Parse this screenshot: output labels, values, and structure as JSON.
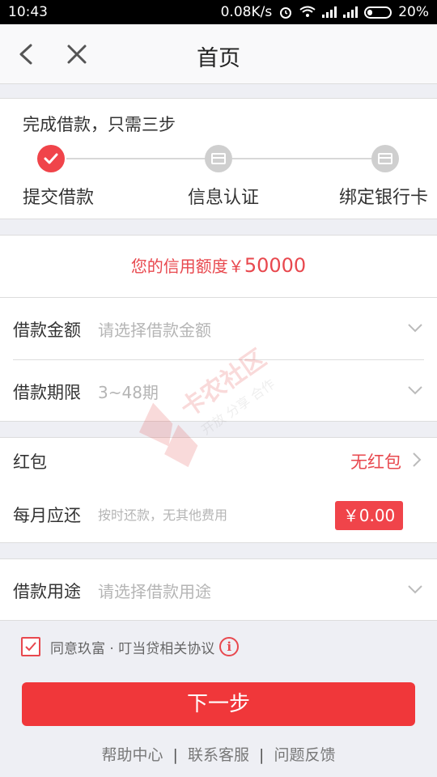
{
  "status_bar": {
    "time": "10:43",
    "speed": "0.08K/s",
    "battery": "20%"
  },
  "nav": {
    "title": "首页"
  },
  "steps": {
    "title": "完成借款，只需三步",
    "items": [
      {
        "label": "提交借款",
        "state": "done"
      },
      {
        "label": "信息认证",
        "state": "todo"
      },
      {
        "label": "绑定银行卡",
        "state": "todo"
      }
    ]
  },
  "credit": {
    "prefix": "您的信用额度￥",
    "amount": "50000"
  },
  "form": {
    "amount": {
      "label": "借款金额",
      "placeholder": "请选择借款金额"
    },
    "term": {
      "label": "借款期限",
      "placeholder": "3~48期"
    }
  },
  "bonus": {
    "label": "红包",
    "value": "无红包"
  },
  "monthly": {
    "label": "每月应还",
    "note": "按时还款，无其他费用",
    "amount": "￥0.00"
  },
  "purpose": {
    "label": "借款用途",
    "placeholder": "请选择借款用途"
  },
  "agreement": {
    "checked": true,
    "text": "同意玖富 · 叮当贷相关协议",
    "info": "i"
  },
  "next_button": "下一步",
  "footer": {
    "help": "帮助中心",
    "sep": "|",
    "contact": "联系客服",
    "feedback": "问题反馈"
  },
  "watermark": {
    "line1": "卡农社区",
    "line2": "开放 分享 合作"
  },
  "colors": {
    "accent": "#f0444a",
    "button": "#f0373a"
  }
}
